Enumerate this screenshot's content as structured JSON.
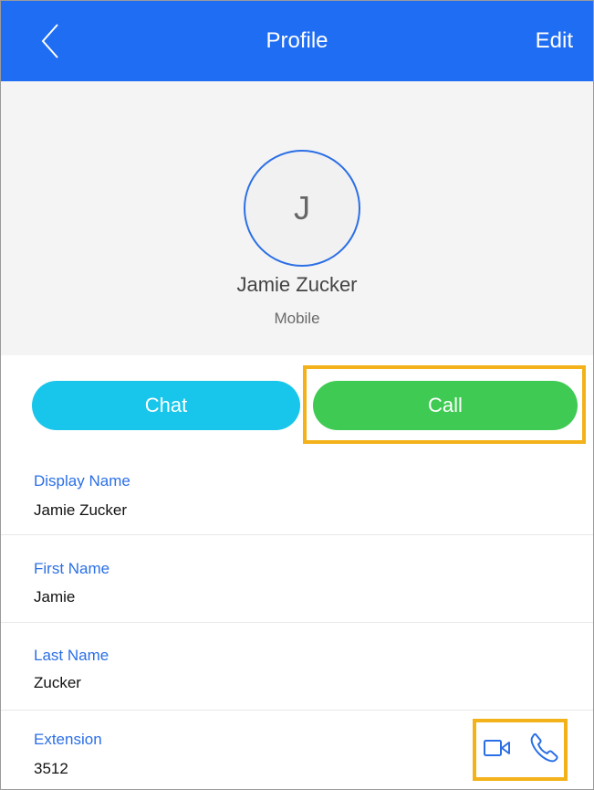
{
  "header": {
    "title": "Profile",
    "edit_label": "Edit"
  },
  "profile": {
    "initial": "J",
    "name": "Jamie Zucker",
    "subtitle": "Mobile"
  },
  "actions": {
    "chat_label": "Chat",
    "call_label": "Call"
  },
  "fields": [
    {
      "label": "Display Name",
      "value": "Jamie Zucker"
    },
    {
      "label": "First Name",
      "value": "Jamie"
    },
    {
      "label": "Last Name",
      "value": "Zucker"
    },
    {
      "label": "Extension",
      "value": "3512"
    }
  ],
  "icons": {
    "back": "chevron-left-icon",
    "video": "video-camera-icon",
    "phone": "phone-icon"
  },
  "colors": {
    "header_bg": "#1f6df2",
    "chat_button": "#17c6ea",
    "call_button": "#3fcb53",
    "highlight": "#f3b21a",
    "label_blue": "#2b6fe6"
  }
}
